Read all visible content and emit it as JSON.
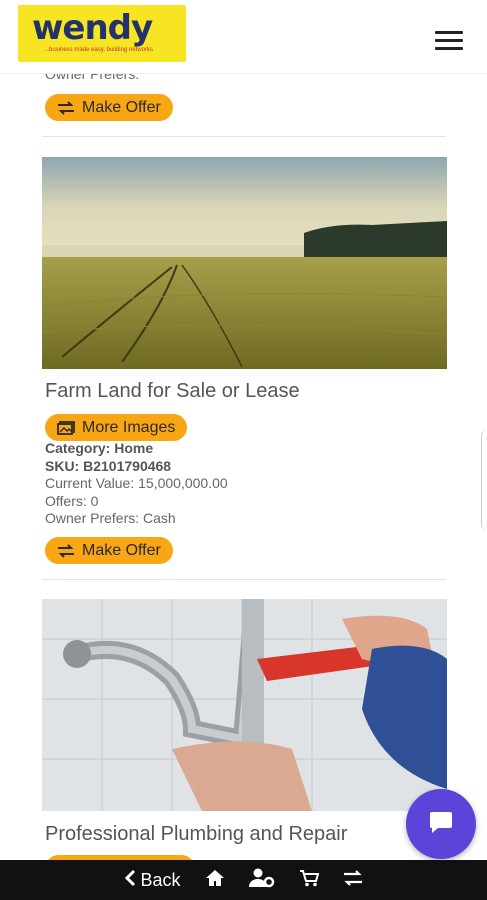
{
  "header": {
    "logo_text": "wendy",
    "logo_tagline": "...business made easy, building networks",
    "menu_icon": "hamburger-menu-icon"
  },
  "listing_prev": {
    "owner_prefers": "Owner Prefers:",
    "offer_label": "Make Offer"
  },
  "listing_farm": {
    "title": "Farm Land for Sale or Lease",
    "images_label": "More Images",
    "category": "Category: Home",
    "sku": "SKU: B2101790468",
    "current_value": "Current Value: 15,000,000.00",
    "offers": "Offers: 0",
    "owner_prefers": "Owner Prefers: Cash",
    "offer_label": "Make Offer"
  },
  "listing_plumbing": {
    "title": "Professional Plumbing and Repair"
  },
  "bottom_nav": {
    "back_label": "Back",
    "icons": [
      "chevron-left-icon",
      "home-icon",
      "user-cog-icon",
      "cart-icon",
      "exchange-icon"
    ]
  },
  "colors": {
    "accent": "#f8a614",
    "logo_bg": "#f7e423",
    "chat_fab": "#5b45d8",
    "bottom_bar": "#111111"
  }
}
